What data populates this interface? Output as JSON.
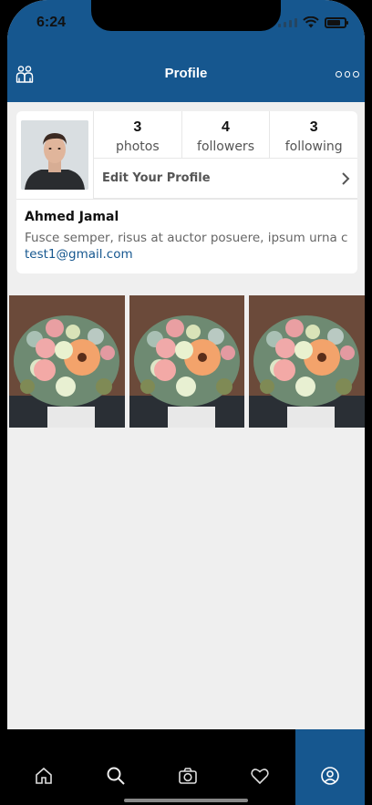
{
  "status_bar": {
    "time": "6:24"
  },
  "header": {
    "title": "Profile",
    "left_icon": "friends-icon",
    "right_icon": "more-icon"
  },
  "profile": {
    "stats": [
      {
        "value": "3",
        "label": "photos"
      },
      {
        "value": "4",
        "label": "followers"
      },
      {
        "value": "3",
        "label": "following"
      }
    ],
    "edit_label": "Edit Your Profile",
    "name": "Ahmed Jamal",
    "bio": "Fusce semper, risus at auctor posuere, ipsum urna c",
    "email": "test1@gmail.com"
  },
  "photos": [
    "flower-bouquet",
    "flower-bouquet",
    "flower-bouquet"
  ],
  "tabbar": {
    "tabs": [
      "home-icon",
      "search-icon",
      "camera-icon",
      "heart-icon",
      "profile-icon"
    ],
    "active": "profile-icon",
    "active_color": "#16578f"
  },
  "colors": {
    "primary": "#16578f",
    "background": "#efefef"
  }
}
